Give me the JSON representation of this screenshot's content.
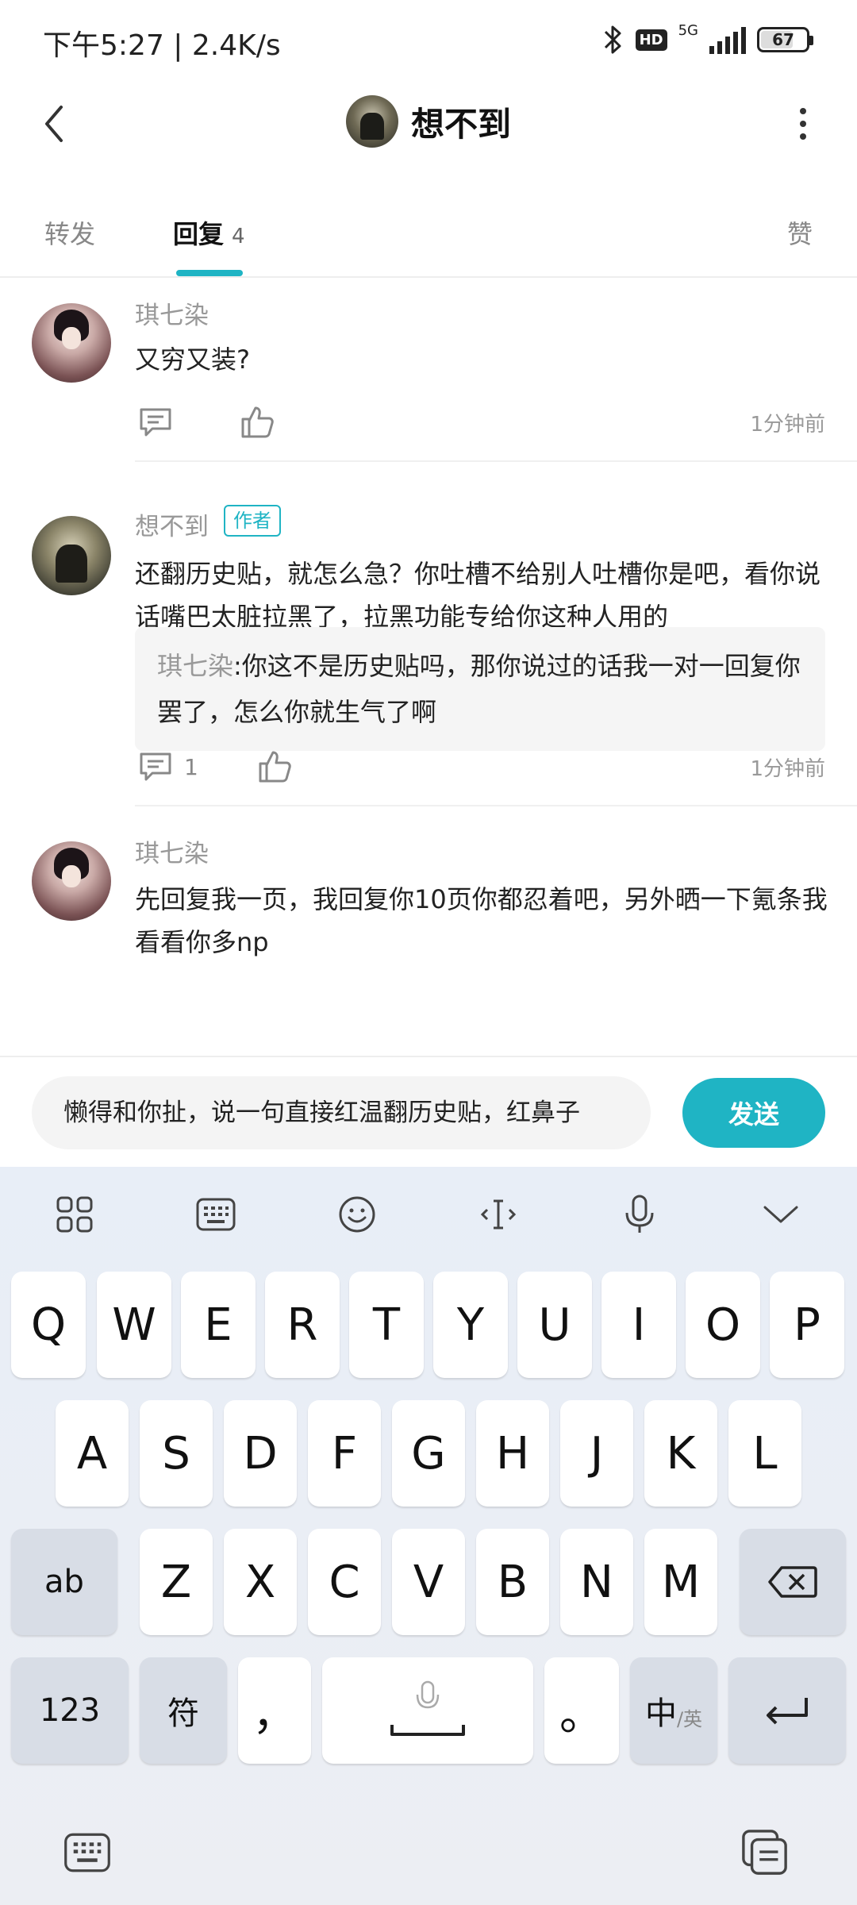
{
  "status_bar": {
    "time": "下午5:27 | 2.4K/s",
    "hd": "HD",
    "network": "5G",
    "battery": "67"
  },
  "header": {
    "title": "想不到"
  },
  "tabs": {
    "forward": "转发",
    "reply": "回复",
    "reply_count": "4",
    "like": "赞"
  },
  "comments": [
    {
      "name": "琪七染",
      "text": "又穷又装?",
      "time": "1分钟前"
    },
    {
      "name": "想不到",
      "badge": "作者",
      "text": "还翻历史贴，就怎么急？你吐槽不给别人吐槽你是吧，看你说话嘴巴太脏拉黑了，拉黑功能专给你这种人用的",
      "quote_name": "琪七染",
      "quote_text": ":你这不是历史贴吗，那你说过的话我一对一回复你罢了，怎么你就生气了啊",
      "comment_count": "1",
      "time": "1分钟前"
    },
    {
      "name": "琪七染",
      "text": "先回复我一页，我回复你10页你都忍着吧，另外晒一下氪条我看看你多np"
    }
  ],
  "input": {
    "value": "懒得和你扯，说一句直接红温翻历史贴，红鼻子",
    "send_label": "发送"
  },
  "keyboard": {
    "row1": [
      "Q",
      "W",
      "E",
      "R",
      "T",
      "Y",
      "U",
      "I",
      "O",
      "P"
    ],
    "row2": [
      "A",
      "S",
      "D",
      "F",
      "G",
      "H",
      "J",
      "K",
      "L"
    ],
    "row3": [
      "Z",
      "X",
      "C",
      "V",
      "B",
      "N",
      "M"
    ],
    "ab_label": "ab",
    "num_label": "123",
    "symbol_label": "符",
    "comma": "，",
    "period": "。",
    "lang_main": "中",
    "lang_sub": "/英"
  },
  "colors": {
    "accent": "#1fb4c4",
    "keyboard_bg": "#e8eef7"
  }
}
